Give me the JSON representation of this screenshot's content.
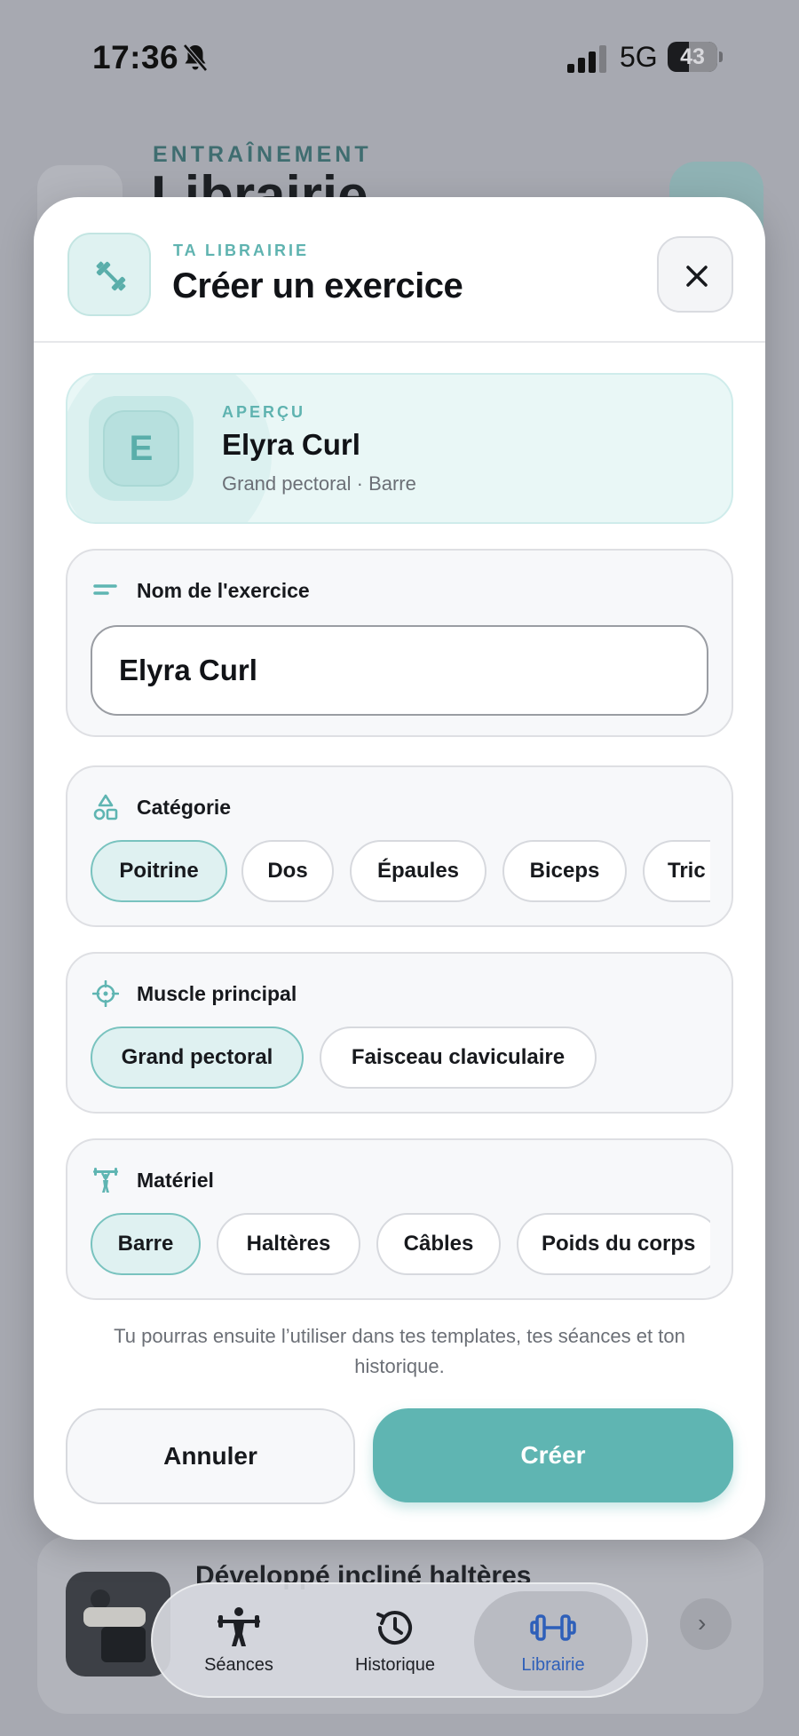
{
  "status_bar": {
    "time": "17:36",
    "network": "5G",
    "battery": "43",
    "battery_level": 0.43,
    "icons": [
      "bell-off-icon",
      "signal-icon",
      "battery-icon"
    ]
  },
  "background": {
    "section_label": "ENTRAÎNEMENT",
    "page_title": "Librairie",
    "card_title": "Développé incliné haltères"
  },
  "tab_bar": {
    "tabs": [
      {
        "label": "Séances",
        "icon": "weightlifter-icon",
        "active": false
      },
      {
        "label": "Historique",
        "icon": "history-icon",
        "active": false
      },
      {
        "label": "Librairie",
        "icon": "dumbbell-icon",
        "active": true
      }
    ]
  },
  "modal": {
    "kicker": "TA LIBRAIRIE",
    "title": "Créer un exercice",
    "header_icon": "dumbbell-icon",
    "close_icon": "close-icon",
    "preview": {
      "kicker": "APERÇU",
      "initial": "E",
      "name": "Elyra Curl",
      "subtitle": "Grand pectoral · Barre"
    },
    "name_section": {
      "label": "Nom de l'exercice",
      "icon": "text-lines-icon",
      "value": "Elyra Curl"
    },
    "category_section": {
      "label": "Catégorie",
      "icon": "shapes-icon",
      "options": [
        "Poitrine",
        "Dos",
        "Épaules",
        "Biceps",
        "Tric"
      ],
      "selected": "Poitrine"
    },
    "muscle_section": {
      "label": "Muscle principal",
      "icon": "target-icon",
      "options": [
        "Grand pectoral",
        "Faisceau claviculaire"
      ],
      "selected": "Grand pectoral"
    },
    "equipment_section": {
      "label": "Matériel",
      "icon": "weightlifter-icon",
      "options": [
        "Barre",
        "Haltères",
        "Câbles",
        "Poids du corps"
      ],
      "selected": "Barre"
    },
    "footnote": "Tu pourras ensuite l’utiliser dans tes templates, tes séances et ton historique.",
    "cancel_label": "Annuler",
    "create_label": "Créer"
  },
  "colors": {
    "accent": "#5fb5b2",
    "accent_light": "#dff1f1",
    "active_tab_text": "#2e5fb9",
    "overlay": "#a7a9b1"
  }
}
